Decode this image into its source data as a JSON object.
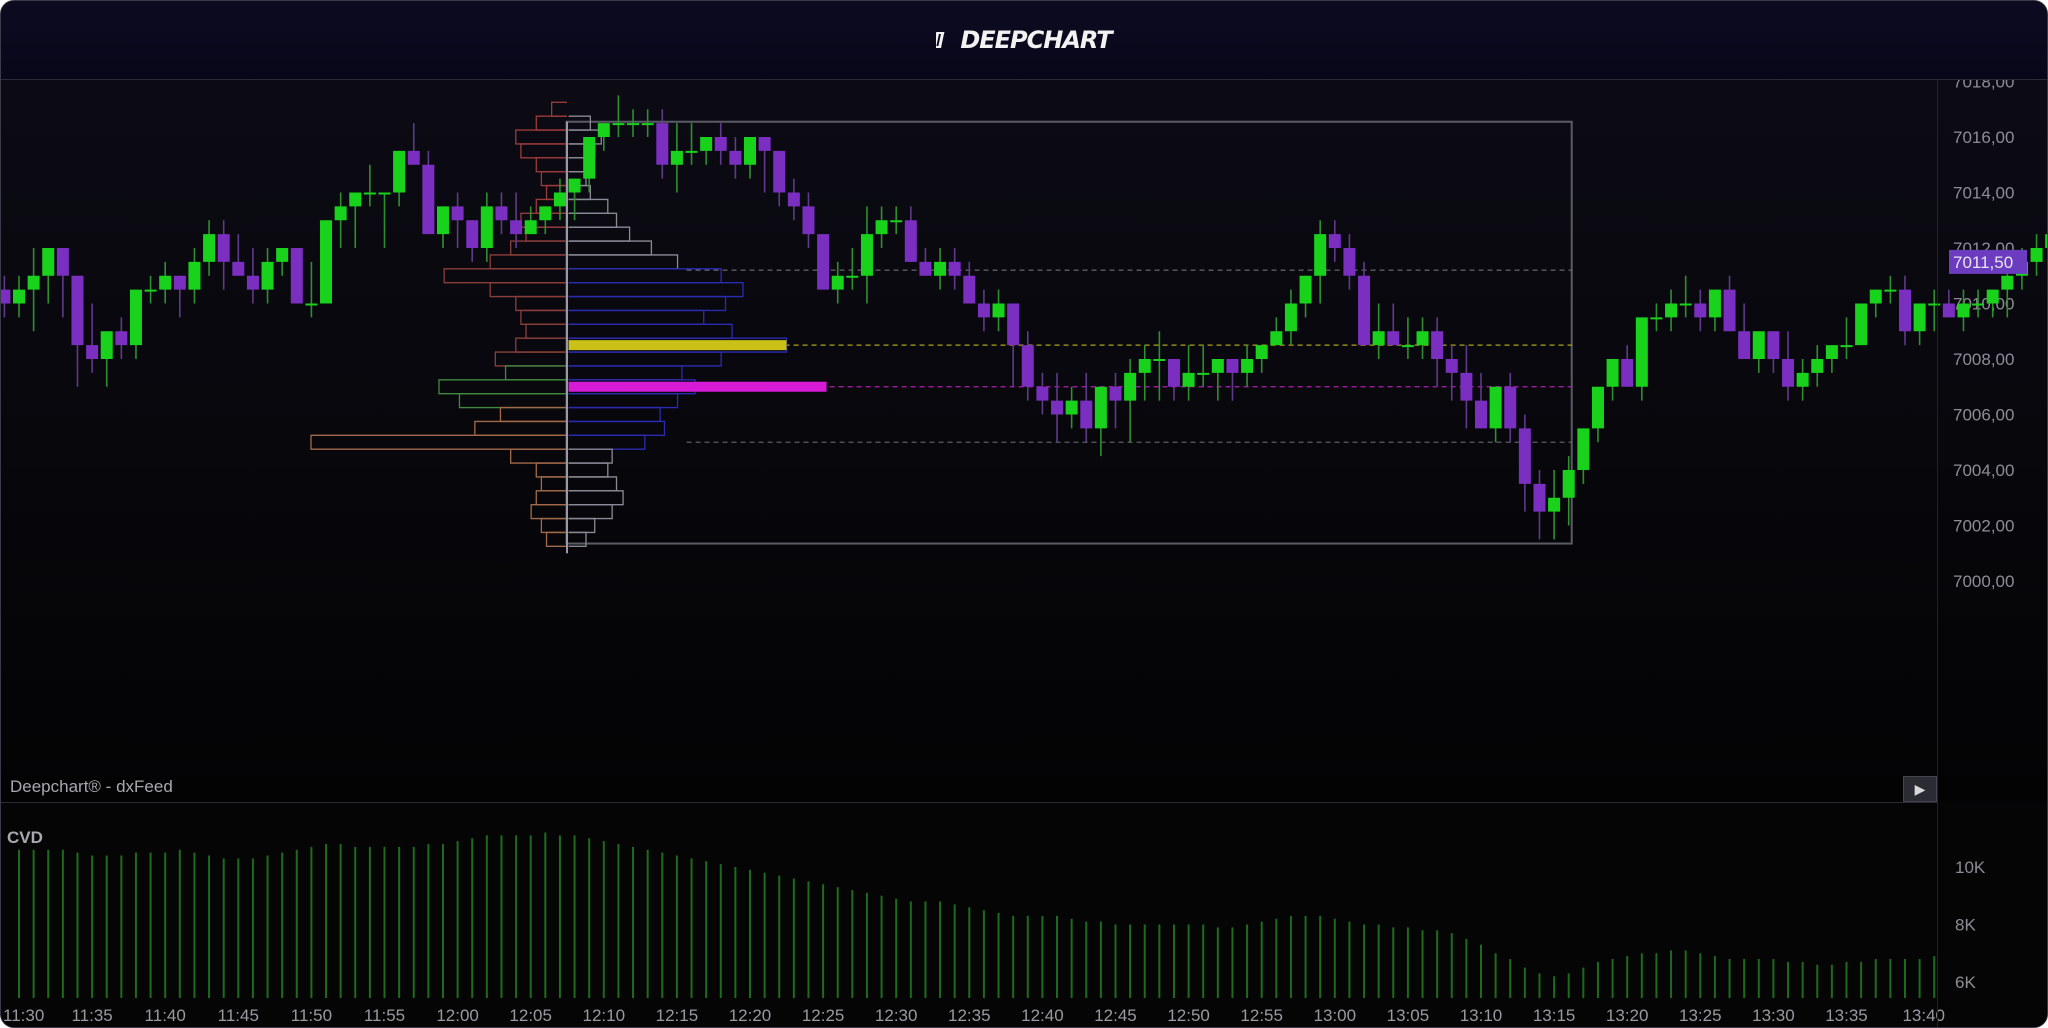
{
  "app": {
    "logo_text": "DEEPCHART"
  },
  "price_chart": {
    "source_label": "Deepchart® - dxFeed",
    "current_price_label": "7011,50",
    "price_axis_labels": [
      "7018,00",
      "7016,00",
      "7014,00",
      "7012,00",
      "7010,00",
      "7008,00",
      "7006,00",
      "7004,00",
      "7002,00",
      "7000,00"
    ],
    "time_axis_labels": [
      "11:30",
      "11:35",
      "11:40",
      "11:45",
      "11:50",
      "11:55",
      "12:00",
      "12:05",
      "12:10",
      "12:15",
      "12:20",
      "12:25",
      "12:30",
      "12:35",
      "12:40",
      "12:45",
      "12:50",
      "12:55",
      "13:00",
      "13:05",
      "13:10",
      "13:15",
      "13:20",
      "13:25",
      "13:30",
      "13:35",
      "13:40"
    ],
    "levels": {
      "poc_yellow": 7008.5,
      "poc_magenta": 7007.0,
      "range_high": 7011.2,
      "range_low": 7005.0
    },
    "colors": {
      "up": "#19d21b",
      "down": "#7a2fc0",
      "poc_yellow": "#c9c117",
      "poc_magenta": "#d61ad6",
      "price_tag": "#6c3cc0"
    }
  },
  "cvd": {
    "title": "CVD",
    "axis_labels": [
      "10K",
      "8K",
      "6K"
    ]
  },
  "controls": {
    "play_glyph": "▶"
  },
  "chart_data": [
    {
      "type": "candlestick",
      "title": "",
      "ylim": [
        6999.2,
        7018.3
      ],
      "xlim": [
        "11:30",
        "13:40"
      ],
      "bar_interval": "1 min",
      "ohlc": [
        [
          7010.5,
          7011.0,
          7009.5,
          7010.0
        ],
        [
          7010.0,
          7011.0,
          7009.5,
          7010.5
        ],
        [
          7010.5,
          7012.0,
          7009.0,
          7011.0
        ],
        [
          7011.0,
          7012.0,
          7010.0,
          7012.0
        ],
        [
          7012.0,
          7012.0,
          7009.5,
          7011.0
        ],
        [
          7011.0,
          7011.0,
          7007.0,
          7008.5
        ],
        [
          7008.5,
          7010.0,
          7007.5,
          7008.0
        ],
        [
          7008.0,
          7008.5,
          7007.0,
          7009.0
        ],
        [
          7009.0,
          7009.5,
          7008.0,
          7008.5
        ],
        [
          7008.5,
          7010.5,
          7008.0,
          7010.5
        ],
        [
          7010.5,
          7011.0,
          7010.0,
          7010.5
        ],
        [
          7010.5,
          7011.5,
          7010.0,
          7011.0
        ],
        [
          7011.0,
          7011.0,
          7009.5,
          7010.5
        ],
        [
          7010.5,
          7012.0,
          7010.0,
          7011.5
        ],
        [
          7011.5,
          7013.0,
          7011.0,
          7012.5
        ],
        [
          7012.5,
          7013.0,
          7010.5,
          7011.5
        ],
        [
          7011.5,
          7012.5,
          7011.0,
          7011.0
        ],
        [
          7011.0,
          7012.0,
          7010.0,
          7010.5
        ],
        [
          7010.5,
          7012.0,
          7010.0,
          7011.5
        ],
        [
          7011.5,
          7012.0,
          7011.0,
          7012.0
        ],
        [
          7012.0,
          7012.0,
          7010.0,
          7010.0
        ],
        [
          7010.0,
          7011.5,
          7009.5,
          7010.0
        ],
        [
          7010.0,
          7013.0,
          7010.0,
          7013.0
        ],
        [
          7013.0,
          7014.0,
          7012.0,
          7013.5
        ],
        [
          7013.5,
          7014.0,
          7012.0,
          7014.0
        ],
        [
          7014.0,
          7015.0,
          7013.5,
          7014.0
        ],
        [
          7014.0,
          7014.0,
          7012.0,
          7014.0
        ],
        [
          7014.0,
          7015.5,
          7013.5,
          7015.5
        ],
        [
          7015.5,
          7016.5,
          7015.0,
          7015.0
        ],
        [
          7015.0,
          7015.5,
          7013.0,
          7012.5
        ],
        [
          7012.5,
          7013.5,
          7012.0,
          7013.5
        ],
        [
          7013.5,
          7014.0,
          7012.0,
          7013.0
        ],
        [
          7013.0,
          7013.0,
          7011.5,
          7012.0
        ],
        [
          7012.0,
          7014.0,
          7011.5,
          7013.5
        ],
        [
          7013.5,
          7014.0,
          7012.5,
          7013.0
        ],
        [
          7013.0,
          7014.0,
          7012.0,
          7012.5
        ],
        [
          7012.5,
          7013.5,
          7012.5,
          7013.0
        ],
        [
          7013.0,
          7013.5,
          7012.5,
          7013.5
        ],
        [
          7013.5,
          7014.5,
          7013.0,
          7014.0
        ],
        [
          7014.0,
          7014.5,
          7013.0,
          7014.5
        ],
        [
          7014.5,
          7016.0,
          7014.0,
          7016.0
        ],
        [
          7016.0,
          7016.5,
          7015.5,
          7016.5
        ],
        [
          7016.5,
          7017.5,
          7016.0,
          7016.5
        ],
        [
          7016.5,
          7017.0,
          7016.0,
          7016.5
        ],
        [
          7016.5,
          7017.0,
          7016.0,
          7016.5
        ],
        [
          7016.5,
          7017.0,
          7014.5,
          7015.0
        ],
        [
          7015.0,
          7016.5,
          7014.0,
          7015.5
        ],
        [
          7015.5,
          7016.5,
          7015.0,
          7015.5
        ],
        [
          7015.5,
          7015.5,
          7015.0,
          7016.0
        ],
        [
          7016.0,
          7016.5,
          7015.0,
          7015.5
        ],
        [
          7015.5,
          7016.0,
          7014.5,
          7015.0
        ],
        [
          7015.0,
          7016.0,
          7014.5,
          7016.0
        ],
        [
          7016.0,
          7016.0,
          7014.0,
          7015.5
        ],
        [
          7015.5,
          7015.5,
          7013.5,
          7014.0
        ],
        [
          7014.0,
          7014.5,
          7013.0,
          7013.5
        ],
        [
          7013.5,
          7014.0,
          7012.0,
          7012.5
        ],
        [
          7012.5,
          7012.5,
          7010.5,
          7010.5
        ],
        [
          7010.5,
          7011.5,
          7010.0,
          7011.0
        ],
        [
          7011.0,
          7012.0,
          7010.5,
          7011.0
        ],
        [
          7011.0,
          7013.5,
          7010.0,
          7012.5
        ],
        [
          7012.5,
          7013.5,
          7012.0,
          7013.0
        ],
        [
          7013.0,
          7013.5,
          7012.5,
          7013.0
        ],
        [
          7013.0,
          7013.5,
          7011.5,
          7011.5
        ],
        [
          7011.5,
          7012.0,
          7011.0,
          7011.0
        ],
        [
          7011.0,
          7012.0,
          7010.5,
          7011.5
        ],
        [
          7011.5,
          7012.0,
          7010.5,
          7011.0
        ],
        [
          7011.0,
          7011.5,
          7010.0,
          7010.0
        ],
        [
          7010.0,
          7010.5,
          7009.0,
          7009.5
        ],
        [
          7009.5,
          7010.5,
          7009.0,
          7010.0
        ],
        [
          7010.0,
          7010.0,
          7007.0,
          7008.5
        ],
        [
          7008.5,
          7009.0,
          7006.5,
          7007.0
        ],
        [
          7007.0,
          7007.5,
          7006.0,
          7006.5
        ],
        [
          7006.5,
          7007.5,
          7005.0,
          7006.0
        ],
        [
          7006.0,
          7007.0,
          7005.5,
          7006.5
        ],
        [
          7006.5,
          7007.5,
          7005.0,
          7005.5
        ],
        [
          7005.5,
          7007.0,
          7004.5,
          7007.0
        ],
        [
          7007.0,
          7007.5,
          7005.5,
          7006.5
        ],
        [
          7006.5,
          7008.0,
          7005.0,
          7007.5
        ],
        [
          7007.5,
          7008.5,
          7006.5,
          7008.0
        ],
        [
          7008.0,
          7009.0,
          7006.5,
          7008.0
        ],
        [
          7008.0,
          7008.0,
          7006.5,
          7007.0
        ],
        [
          7007.0,
          7008.5,
          7006.5,
          7007.5
        ],
        [
          7007.5,
          7008.5,
          7007.0,
          7007.5
        ],
        [
          7007.5,
          7008.0,
          7006.5,
          7008.0
        ],
        [
          7008.0,
          7008.0,
          7006.5,
          7007.5
        ],
        [
          7007.5,
          7008.5,
          7007.0,
          7008.0
        ],
        [
          7008.0,
          7008.5,
          7007.5,
          7008.5
        ],
        [
          7008.5,
          7009.5,
          7008.5,
          7009.0
        ],
        [
          7009.0,
          7010.5,
          7008.5,
          7010.0
        ],
        [
          7010.0,
          7011.0,
          7009.5,
          7011.0
        ],
        [
          7011.0,
          7013.0,
          7010.0,
          7012.5
        ],
        [
          7012.5,
          7013.0,
          7011.5,
          7012.0
        ],
        [
          7012.0,
          7012.5,
          7010.5,
          7011.0
        ],
        [
          7011.0,
          7011.5,
          7009.5,
          7008.5
        ],
        [
          7008.5,
          7010.0,
          7008.0,
          7009.0
        ],
        [
          7009.0,
          7010.0,
          7008.5,
          7008.5
        ],
        [
          7008.5,
          7009.5,
          7008.0,
          7008.5
        ],
        [
          7008.5,
          7009.5,
          7008.0,
          7009.0
        ],
        [
          7009.0,
          7009.5,
          7007.0,
          7008.0
        ],
        [
          7008.0,
          7008.5,
          7006.5,
          7007.5
        ],
        [
          7007.5,
          7008.5,
          7005.5,
          7006.5
        ],
        [
          7006.5,
          7007.5,
          7005.5,
          7005.5
        ],
        [
          7005.5,
          7007.0,
          7005.0,
          7007.0
        ],
        [
          7007.0,
          7007.5,
          7005.0,
          7005.5
        ],
        [
          7005.5,
          7006.0,
          7002.5,
          7003.5
        ],
        [
          7003.5,
          7004.0,
          7001.5,
          7002.5
        ],
        [
          7002.5,
          7004.0,
          7001.5,
          7003.0
        ],
        [
          7003.0,
          7004.5,
          7002.0,
          7004.0
        ],
        [
          7004.0,
          7005.5,
          7003.5,
          7005.5
        ],
        [
          7005.5,
          7007.0,
          7005.0,
          7007.0
        ],
        [
          7007.0,
          7008.0,
          7006.5,
          7008.0
        ],
        [
          7008.0,
          7008.5,
          7007.0,
          7007.0
        ],
        [
          7007.0,
          7009.5,
          7006.5,
          7009.5
        ],
        [
          7009.5,
          7010.0,
          7009.0,
          7009.5
        ],
        [
          7009.5,
          7010.5,
          7009.0,
          7010.0
        ],
        [
          7010.0,
          7011.0,
          7009.5,
          7010.0
        ],
        [
          7010.0,
          7010.5,
          7009.0,
          7009.5
        ],
        [
          7009.5,
          7010.5,
          7009.0,
          7010.5
        ],
        [
          7010.5,
          7011.0,
          7009.0,
          7009.0
        ],
        [
          7009.0,
          7010.0,
          7008.5,
          7008.0
        ],
        [
          7008.0,
          7009.0,
          7007.5,
          7009.0
        ],
        [
          7009.0,
          7009.0,
          7007.5,
          7008.0
        ],
        [
          7008.0,
          7009.0,
          7006.5,
          7007.0
        ],
        [
          7007.0,
          7008.0,
          7006.5,
          7007.5
        ],
        [
          7007.5,
          7008.5,
          7007.0,
          7008.0
        ],
        [
          7008.0,
          7008.5,
          7007.5,
          7008.5
        ],
        [
          7008.5,
          7009.5,
          7008.0,
          7008.5
        ],
        [
          7008.5,
          7010.0,
          7008.5,
          7010.0
        ],
        [
          7010.0,
          7010.5,
          7009.5,
          7010.5
        ],
        [
          7010.5,
          7011.0,
          7010.0,
          7010.5
        ],
        [
          7010.5,
          7011.0,
          7008.5,
          7009.0
        ],
        [
          7009.0,
          7010.0,
          7008.5,
          7010.0
        ],
        [
          7010.0,
          7010.5,
          7009.0,
          7010.0
        ],
        [
          7010.0,
          7010.5,
          7009.5,
          7009.5
        ],
        [
          7009.5,
          7010.5,
          7009.0,
          7010.0
        ],
        [
          7010.0,
          7010.5,
          7009.5,
          7010.0
        ],
        [
          7010.0,
          7010.5,
          7009.5,
          7010.5
        ],
        [
          7010.5,
          7011.5,
          7009.5,
          7011.0
        ],
        [
          7011.0,
          7012.0,
          7010.5,
          7011.5
        ],
        [
          7011.5,
          7012.5,
          7011.0,
          7012.0
        ],
        [
          7012.0,
          7013.0,
          7011.5,
          7012.5
        ],
        [
          7012.5,
          7013.5,
          7011.0,
          7012.0
        ],
        [
          7012.0,
          7013.0,
          7011.5,
          7013.0
        ],
        [
          7013.0,
          7014.0,
          7012.5,
          7013.5
        ],
        [
          7013.5,
          7015.0,
          7013.0,
          7014.5
        ],
        [
          7014.5,
          7015.5,
          7013.5,
          7014.5
        ],
        [
          7014.5,
          7015.0,
          7013.5,
          7013.5
        ],
        [
          7013.5,
          7014.0,
          7012.0,
          7011.5
        ],
        [
          7011.5,
          7012.5,
          7010.5,
          7012.0
        ],
        [
          7012.0,
          7012.5,
          7011.0,
          7011.5
        ]
      ]
    },
    {
      "type": "bar",
      "title": "CVD",
      "ylim": [
        5200,
        12000
      ],
      "values": [
        10600,
        10600,
        10600,
        10600,
        10500,
        10400,
        10400,
        10400,
        10500,
        10500,
        10500,
        10600,
        10500,
        10400,
        10300,
        10300,
        10300,
        10400,
        10500,
        10600,
        10700,
        10800,
        10800,
        10700,
        10700,
        10700,
        10700,
        10700,
        10800,
        10800,
        10900,
        11000,
        11100,
        11100,
        11100,
        11100,
        11200,
        11100,
        11100,
        11000,
        10900,
        10800,
        10700,
        10600,
        10500,
        10400,
        10300,
        10200,
        10100,
        10000,
        9900,
        9800,
        9700,
        9600,
        9500,
        9400,
        9300,
        9200,
        9100,
        9000,
        8900,
        8800,
        8800,
        8800,
        8700,
        8600,
        8500,
        8400,
        8300,
        8300,
        8300,
        8300,
        8200,
        8100,
        8100,
        8000,
        8000,
        8000,
        8000,
        8000,
        8000,
        8000,
        7900,
        7900,
        8000,
        8100,
        8200,
        8300,
        8300,
        8300,
        8200,
        8100,
        8000,
        8000,
        7900,
        7900,
        7800,
        7800,
        7700,
        7500,
        7300,
        7000,
        6800,
        6500,
        6300,
        6200,
        6300,
        6500,
        6700,
        6800,
        6900,
        7000,
        7000,
        7100,
        7100,
        7000,
        6900,
        6800,
        6800,
        6800,
        6800,
        6700,
        6700,
        6600,
        6600,
        6700,
        6700,
        6800,
        6800,
        6800,
        6800,
        6900,
        6900,
        7000,
        7000,
        7000,
        6900,
        6900,
        6900,
        6800,
        6800,
        6700,
        6700,
        6700,
        6700,
        6700
      ]
    },
    {
      "type": "area",
      "title": "volume profile (range box)",
      "bins": [
        7016.5,
        7016.0,
        7015.5,
        7015.0,
        7014.5,
        7014.0,
        7013.5,
        7013.0,
        7012.5,
        7012.0,
        7011.5,
        7011.0,
        7010.5,
        7010.0,
        7009.5,
        7009.0,
        7008.5,
        7008.0,
        7007.5,
        7007.0,
        7006.5,
        7006.0,
        7005.5,
        7005.0,
        7004.5,
        7004.0,
        7003.5,
        7003.0,
        7002.5,
        7002.0,
        7001.5
      ],
      "values": [
        10,
        15,
        12,
        10,
        8,
        10,
        18,
        22,
        28,
        38,
        50,
        70,
        80,
        72,
        62,
        75,
        100,
        70,
        52,
        58,
        50,
        42,
        44,
        35,
        20,
        18,
        22,
        25,
        20,
        12,
        8
      ]
    },
    {
      "type": "area",
      "title": "volume profile (left)",
      "bins": [
        7017.0,
        7016.5,
        7016.0,
        7015.5,
        7015.0,
        7014.5,
        7014.0,
        7013.5,
        7013.0,
        7012.5,
        7012.0,
        7011.5,
        7011.0,
        7010.5,
        7010.0,
        7009.5,
        7009.0,
        7008.5,
        7008.0,
        7007.5,
        7007.0,
        7006.5,
        7006.0,
        7005.5,
        7005.0,
        7004.5,
        7004.0,
        7003.5,
        7003.0,
        7002.5,
        7002.0,
        7001.5
      ],
      "values": [
        6,
        12,
        20,
        18,
        12,
        10,
        8,
        12,
        18,
        16,
        22,
        30,
        48,
        30,
        20,
        18,
        16,
        20,
        28,
        24,
        50,
        42,
        26,
        36,
        100,
        22,
        12,
        10,
        12,
        14,
        10,
        8
      ]
    }
  ]
}
